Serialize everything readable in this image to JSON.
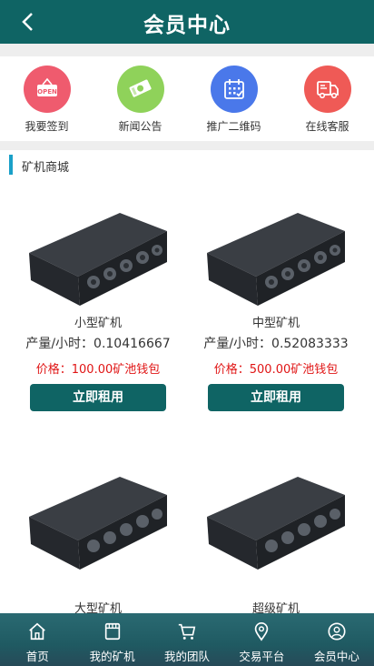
{
  "header": {
    "title": "会员中心",
    "back_icon": "chevron-left-icon"
  },
  "quick_actions": [
    {
      "label": "我要签到",
      "icon": "open-sign-icon",
      "color": "#ef5b6e"
    },
    {
      "label": "新闻公告",
      "icon": "money-icon",
      "color": "#8fd25a"
    },
    {
      "label": "推广二维码",
      "icon": "calendar-icon",
      "color": "#4a78ea"
    },
    {
      "label": "在线客服",
      "icon": "truck-icon",
      "color": "#ef5a56"
    }
  ],
  "section": {
    "title": "矿机商城"
  },
  "products": [
    {
      "name": "小型矿机",
      "rate": "产量/小时：0.10416667",
      "price": "价格：100.00矿池钱包",
      "button": "立即租用"
    },
    {
      "name": "中型矿机",
      "rate": "产量/小时：0.52083333",
      "price": "价格：500.00矿池钱包",
      "button": "立即租用"
    },
    {
      "name": "大型矿机"
    },
    {
      "name": "超级矿机"
    }
  ],
  "tabbar": [
    {
      "label": "首页",
      "icon": "home-icon"
    },
    {
      "label": "我的矿机",
      "icon": "store-icon"
    },
    {
      "label": "我的团队",
      "icon": "cart-icon"
    },
    {
      "label": "交易平台",
      "icon": "location-icon"
    },
    {
      "label": "会员中心",
      "icon": "user-icon"
    }
  ],
  "colors": {
    "primary": "#0f6464",
    "price": "#e01515",
    "accent": "#1aa0c8"
  }
}
